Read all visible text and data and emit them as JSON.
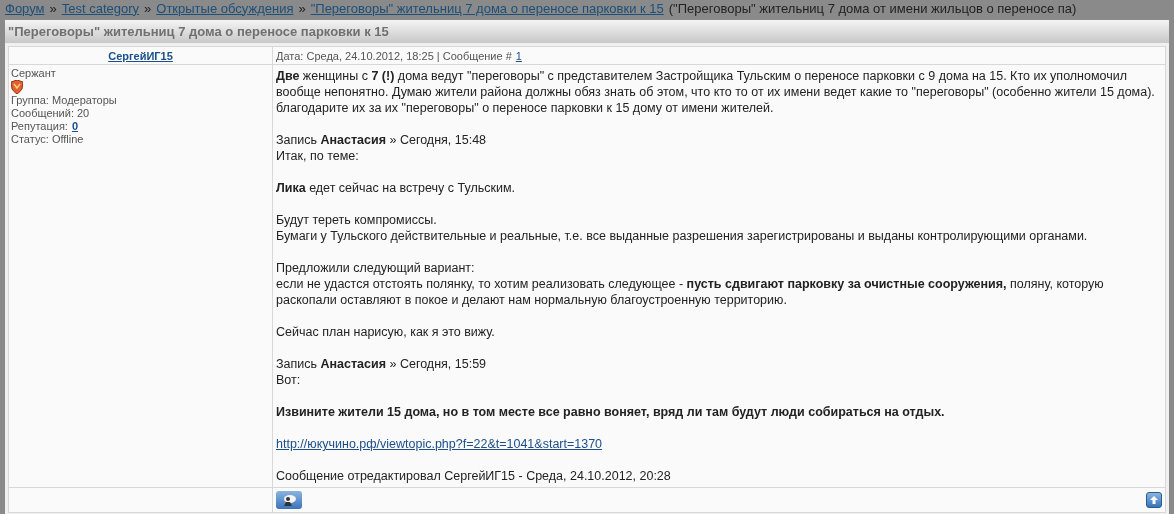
{
  "breadcrumbs": [
    {
      "label": "Форум"
    },
    {
      "label": "Test category"
    },
    {
      "label": "Открытые обсуждения"
    },
    {
      "label": "\"Переговоры\" жительниц 7 дома о переносе парковки к 15"
    }
  ],
  "breadcrumb_separator": "»",
  "breadcrumb_note": "(\"Переговоры\" жительниц 7 дома от имени жильцов о переносе па)",
  "topic_title": "\"Переговоры\" жительниц 7 дома о переносе парковки к 15",
  "post": {
    "author": "СергейИГ15",
    "rank": "Сержант",
    "group": "Группа: Модераторы",
    "messages": "Сообщений: 20",
    "reputation_label": "Репутация:",
    "reputation": "0",
    "status": "Статус: Offline",
    "date": "Дата: Среда, 24.10.2012, 18:25 | Сообщение #",
    "number": "1",
    "body": [
      {
        "kind": "text",
        "lines": [
          "**Две** женщины с **7 (!)** дома ведут \"переговоры\" с представителем Застройщика Тульским о переносе парковки с 9 дома на 15. Кто их уполномочил вообще непонятно. Думаю жители района должны обяз знать об этом, что кто то от их имени ведет какие то \"переговоры\" (особенно жители 15 дома). благодарите их за их \"переговоры\" о переносе парковки к 15 дому от имени жителей."
        ]
      },
      {
        "kind": "text",
        "lines": [
          "Запись **Анастасия** » Сегодня, 15:48",
          "Итак, по теме:"
        ]
      },
      {
        "kind": "text",
        "lines": [
          "**Лика** едет сейчас на встречу с Тульским."
        ]
      },
      {
        "kind": "text",
        "lines": [
          "Будут тереть компромиссы.",
          "Бумаги у Тульского действительные и реальные, т.е. все выданные разрешения зарегистрированы и выданы контролирующими органами."
        ]
      },
      {
        "kind": "text",
        "lines": [
          "Предложили следующий вариант:",
          "если не удастся отстоять полянку, то хотим реализовать следующее - **пусть сдвигают парковку за очистные сооружения,** поляну, которую раскопали оставляют в покое и делают нам нормальную благоустроенную территорию."
        ]
      },
      {
        "kind": "text",
        "lines": [
          "Сейчас план нарисую, как я это вижу."
        ]
      },
      {
        "kind": "text",
        "lines": [
          "Запись **Анастасия** » Сегодня, 15:59",
          "Вот:"
        ]
      },
      {
        "kind": "bold",
        "lines": [
          "Извините жители 15 дома, но в том месте все равно воняет, вряд ли там будут люди собираться на отдых."
        ]
      },
      {
        "kind": "link",
        "lines": [
          "http://юкучино.рф/viewtopic.php?f=22&t=1041&start=1370"
        ]
      },
      {
        "kind": "text",
        "lines": [
          "Сообщение отредактировал СергейИГ15 - Среда, 24.10.2012, 20:28"
        ]
      }
    ]
  }
}
